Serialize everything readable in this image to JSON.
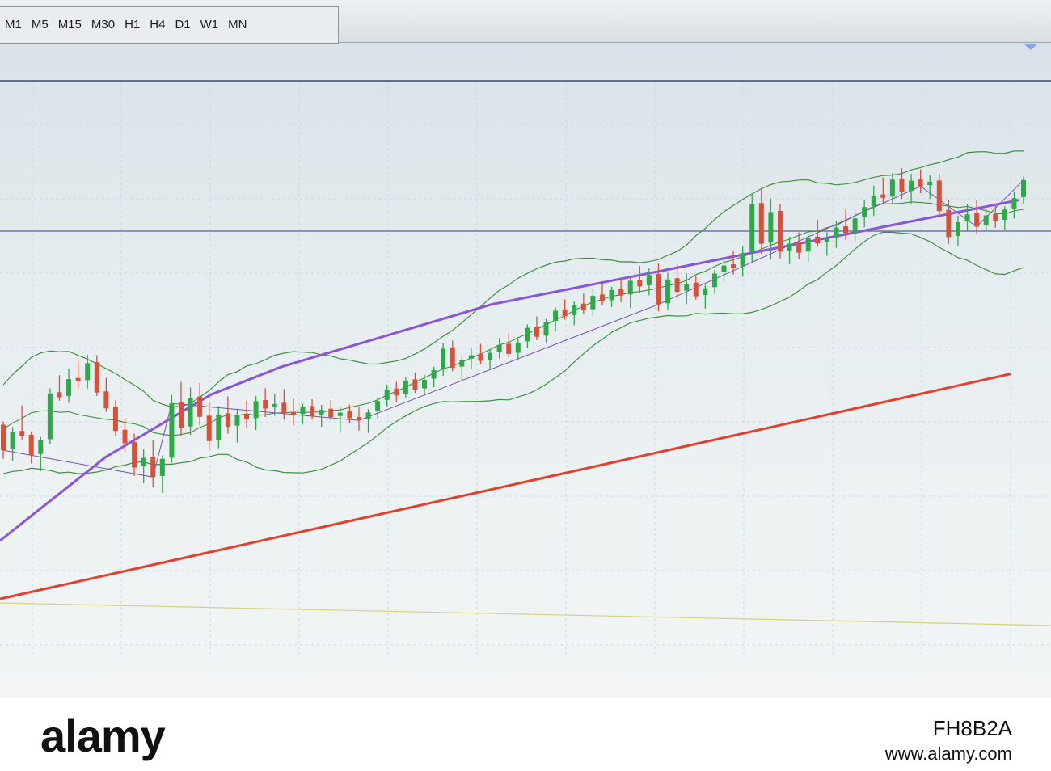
{
  "toolbar": {
    "timeframes": [
      "M1",
      "M5",
      "M15",
      "M30",
      "H1",
      "H4",
      "D1",
      "W1",
      "MN"
    ]
  },
  "colors": {
    "bull_candle": "#2fa84a",
    "bear_candle": "#d9503a",
    "bollinger": "#3f8f3f",
    "ma_purple": "#8a55d6",
    "ma_red": "#e2402e",
    "zigzag": "#7a4fb0",
    "hline": "#5a5a9a",
    "level_yellow": "#d8d27a"
  },
  "chart_data": {
    "type": "candlestick",
    "candles_ohlc": [
      [
        60,
        62,
        40,
        45
      ],
      [
        45,
        58,
        38,
        55
      ],
      [
        55,
        70,
        50,
        52
      ],
      [
        52,
        54,
        35,
        40
      ],
      [
        40,
        50,
        30,
        48
      ],
      [
        48,
        78,
        45,
        75
      ],
      [
        75,
        85,
        70,
        72
      ],
      [
        72,
        88,
        68,
        82
      ],
      [
        82,
        92,
        76,
        80
      ],
      [
        80,
        95,
        75,
        90
      ],
      [
        90,
        94,
        70,
        72
      ],
      [
        72,
        80,
        60,
        62
      ],
      [
        62,
        66,
        45,
        48
      ],
      [
        48,
        55,
        35,
        40
      ],
      [
        40,
        45,
        20,
        25
      ],
      [
        25,
        35,
        15,
        30
      ],
      [
        30,
        40,
        12,
        18
      ],
      [
        18,
        30,
        8,
        28
      ],
      [
        28,
        65,
        25,
        60
      ],
      [
        60,
        72,
        40,
        45
      ],
      [
        45,
        68,
        40,
        62
      ],
      [
        62,
        70,
        45,
        50
      ],
      [
        50,
        58,
        30,
        35
      ],
      [
        35,
        55,
        30,
        50
      ],
      [
        50,
        60,
        38,
        42
      ],
      [
        42,
        52,
        32,
        48
      ],
      [
        48,
        56,
        40,
        45
      ],
      [
        45,
        58,
        38,
        55
      ],
      [
        55,
        62,
        45,
        50
      ],
      [
        50,
        58,
        45,
        52
      ],
      [
        52,
        60,
        42,
        46
      ],
      [
        46,
        54,
        38,
        44
      ],
      [
        44,
        50,
        38,
        48
      ],
      [
        48,
        52,
        40,
        42
      ],
      [
        42,
        48,
        35,
        45
      ],
      [
        45,
        50,
        38,
        40
      ],
      [
        40,
        45,
        30,
        42
      ],
      [
        42,
        46,
        35,
        38
      ],
      [
        38,
        44,
        30,
        36
      ],
      [
        36,
        42,
        28,
        40
      ],
      [
        40,
        48,
        36,
        46
      ],
      [
        46,
        55,
        42,
        52
      ],
      [
        52,
        56,
        44,
        48
      ],
      [
        48,
        58,
        46,
        56
      ],
      [
        56,
        60,
        48,
        50
      ],
      [
        50,
        58,
        46,
        55
      ],
      [
        55,
        62,
        50,
        60
      ],
      [
        60,
        75,
        56,
        72
      ],
      [
        72,
        76,
        58,
        60
      ],
      [
        60,
        66,
        52,
        64
      ],
      [
        64,
        70,
        58,
        66
      ],
      [
        66,
        72,
        60,
        62
      ],
      [
        62,
        68,
        56,
        66
      ],
      [
        66,
        74,
        62,
        70
      ],
      [
        70,
        76,
        62,
        64
      ],
      [
        64,
        72,
        60,
        70
      ],
      [
        70,
        80,
        66,
        78
      ],
      [
        78,
        84,
        70,
        72
      ],
      [
        72,
        82,
        68,
        80
      ],
      [
        80,
        88,
        74,
        86
      ],
      [
        86,
        92,
        80,
        82
      ],
      [
        82,
        90,
        76,
        88
      ],
      [
        88,
        94,
        82,
        84
      ],
      [
        84,
        96,
        80,
        92
      ],
      [
        92,
        98,
        86,
        88
      ],
      [
        88,
        96,
        84,
        94
      ],
      [
        94,
        100,
        86,
        90
      ],
      [
        90,
        100,
        82,
        98
      ],
      [
        98,
        106,
        90,
        94
      ],
      [
        94,
        104,
        88,
        100
      ],
      [
        100,
        106,
        78,
        82
      ],
      [
        82,
        100,
        78,
        96
      ],
      [
        96,
        104,
        84,
        88
      ],
      [
        88,
        98,
        80,
        92
      ],
      [
        92,
        96,
        82,
        84
      ],
      [
        84,
        90,
        76,
        88
      ],
      [
        88,
        98,
        84,
        96
      ],
      [
        96,
        104,
        90,
        100
      ],
      [
        100,
        108,
        94,
        98
      ],
      [
        98,
        110,
        92,
        106
      ],
      [
        106,
        140,
        100,
        134
      ],
      [
        134,
        142,
        104,
        110
      ],
      [
        110,
        136,
        100,
        128
      ],
      [
        128,
        132,
        100,
        104
      ],
      [
        104,
        112,
        96,
        108
      ],
      [
        108,
        114,
        98,
        102
      ],
      [
        102,
        112,
        96,
        110
      ],
      [
        110,
        120,
        104,
        106
      ],
      [
        106,
        112,
        98,
        108
      ],
      [
        108,
        118,
        102,
        114
      ],
      [
        114,
        124,
        106,
        110
      ],
      [
        110,
        122,
        104,
        118
      ],
      [
        118,
        128,
        112,
        124
      ],
      [
        124,
        136,
        118,
        130
      ],
      [
        130,
        140,
        124,
        128
      ],
      [
        128,
        142,
        124,
        138
      ],
      [
        138,
        144,
        126,
        130
      ],
      [
        130,
        140,
        122,
        136
      ],
      [
        136,
        142,
        128,
        132
      ],
      [
        132,
        138,
        124,
        134
      ],
      [
        134,
        138,
        112,
        116
      ],
      [
        116,
        122,
        96,
        100
      ],
      [
        100,
        112,
        94,
        108
      ],
      [
        108,
        118,
        102,
        112
      ],
      [
        112,
        120,
        100,
        104
      ],
      [
        104,
        114,
        100,
        110
      ],
      [
        110,
        116,
        102,
        106
      ],
      [
        106,
        114,
        100,
        112
      ],
      [
        112,
        122,
        106,
        118
      ],
      [
        118,
        130,
        114,
        128
      ]
    ],
    "ma_purple": [
      10,
      18,
      26,
      34,
      40,
      46,
      52,
      56,
      60,
      63,
      66,
      69,
      72,
      75,
      78,
      80,
      82,
      84,
      86,
      88,
      90,
      92,
      94,
      96,
      98,
      100,
      102,
      104,
      106,
      108
    ],
    "ma_red": [
      5,
      8,
      11,
      14,
      17,
      20,
      23,
      26,
      29,
      32,
      35,
      38,
      41,
      44,
      47,
      50,
      53,
      56,
      59,
      62,
      65,
      68,
      71,
      74,
      77,
      80,
      83,
      86,
      89,
      92
    ]
  },
  "footer": {
    "logo": "alamy",
    "image_id": "FH8B2A",
    "url": "www.alamy.com"
  }
}
